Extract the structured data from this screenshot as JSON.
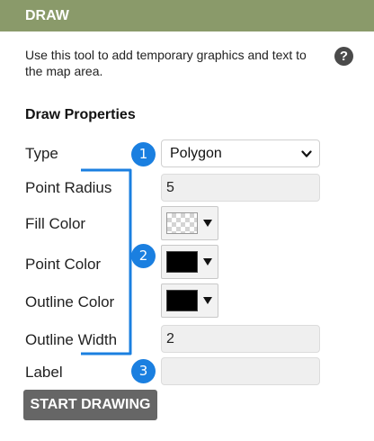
{
  "panel": {
    "title": "DRAW",
    "description": "Use this tool to add temporary graphics and text to the map area.",
    "help_icon": "?"
  },
  "section": {
    "title": "Draw Properties"
  },
  "fields": {
    "type": {
      "label": "Type",
      "value": "Polygon"
    },
    "point_radius": {
      "label": "Point Radius",
      "value": "5"
    },
    "fill_color": {
      "label": "Fill Color",
      "value": "transparent"
    },
    "point_color": {
      "label": "Point Color",
      "value": "#000000"
    },
    "outline_color": {
      "label": "Outline Color",
      "value": "#000000"
    },
    "outline_width": {
      "label": "Outline Width",
      "value": "2"
    },
    "label": {
      "label": "Label",
      "value": ""
    }
  },
  "badges": [
    "1",
    "2",
    "3"
  ],
  "start_button": "START DRAWING",
  "colors": {
    "title_bar": "#8a9a6a",
    "badge": "#1a7fe0",
    "button": "#666666"
  },
  "icons": {
    "help": "question-circle-icon",
    "type_dropdown": "chevron-down-icon",
    "color_picker": "caret-down-icon"
  }
}
